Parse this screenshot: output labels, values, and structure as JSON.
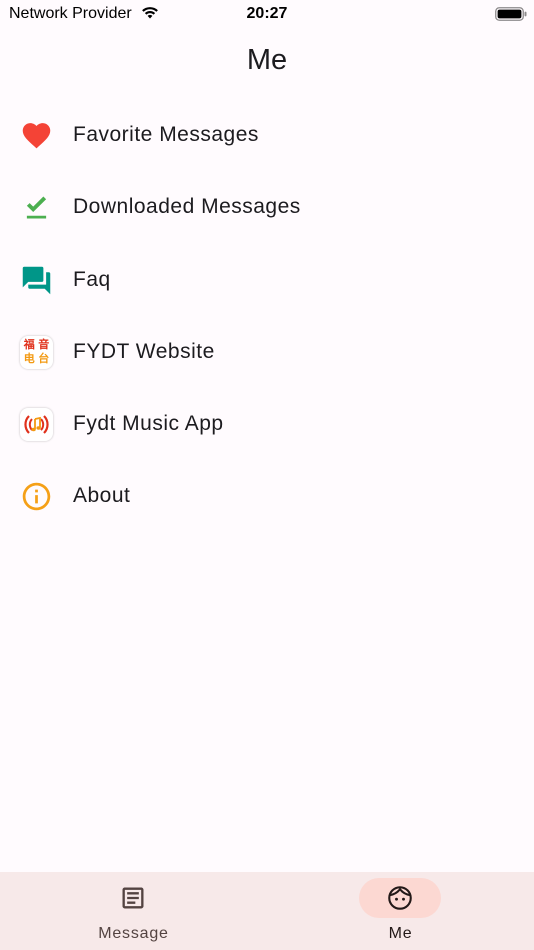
{
  "status_bar": {
    "carrier": "Network Provider",
    "time": "20:27"
  },
  "header": {
    "title": "Me"
  },
  "menu": {
    "items": [
      {
        "label": "Favorite Messages",
        "icon": "heart-icon",
        "icon_color": "#f44336"
      },
      {
        "label": "Downloaded Messages",
        "icon": "download-done-icon",
        "icon_color": "#4caf50"
      },
      {
        "label": "Faq",
        "icon": "forum-icon",
        "icon_color": "#009688"
      },
      {
        "label": "FYDT Website",
        "icon": "fydt-website-logo-icon",
        "logo_text": [
          "福",
          "音",
          "电",
          "台"
        ]
      },
      {
        "label": "Fydt Music App",
        "icon": "fydt-music-app-icon"
      },
      {
        "label": "About",
        "icon": "info-icon",
        "icon_color": "#f5a017"
      }
    ]
  },
  "bottom_nav": {
    "items": [
      {
        "label": "Message",
        "icon": "article-icon",
        "selected": false
      },
      {
        "label": "Me",
        "icon": "face-icon",
        "selected": true
      }
    ],
    "active_indicator_color": "#fcd8d2",
    "background_color": "#f7e9e9"
  }
}
